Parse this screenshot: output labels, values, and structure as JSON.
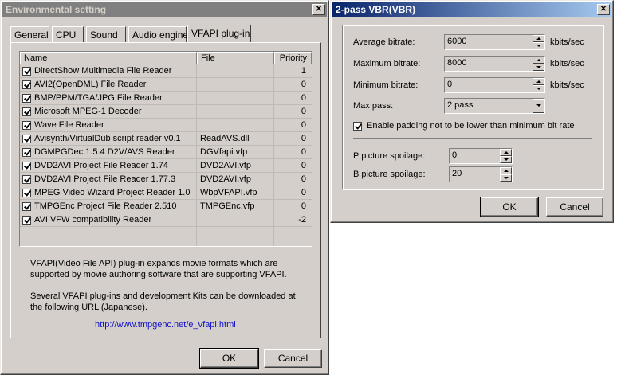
{
  "env_window": {
    "title": "Environmental setting",
    "tabs": [
      "General",
      "CPU",
      "Sound",
      "Audio engine",
      "VFAPI plug-in"
    ],
    "columns": [
      "Name",
      "File",
      "Priority"
    ],
    "rows": [
      {
        "name": "DirectShow Multimedia File Reader",
        "file": "",
        "priority": "1"
      },
      {
        "name": "AVI2(OpenDML) File Reader",
        "file": "",
        "priority": "0"
      },
      {
        "name": "BMP/PPM/TGA/JPG File Reader",
        "file": "",
        "priority": "0"
      },
      {
        "name": "Microsoft MPEG-1 Decoder",
        "file": "",
        "priority": "0"
      },
      {
        "name": "Wave File Reader",
        "file": "",
        "priority": "0"
      },
      {
        "name": "Avisynth/VirtualDub script reader v0.1",
        "file": "ReadAVS.dll",
        "priority": "0"
      },
      {
        "name": "DGMPGDec 1.5.4 D2V/AVS Reader",
        "file": "DGVfapi.vfp",
        "priority": "0"
      },
      {
        "name": "DVD2AVI Project File Reader 1.74",
        "file": "DVD2AVI.vfp",
        "priority": "0"
      },
      {
        "name": "DVD2AVI Project File Reader 1.77.3",
        "file": "DVD2AVI.vfp",
        "priority": "0"
      },
      {
        "name": "MPEG Video Wizard Project Reader 1.0",
        "file": "WbpVFAPI.vfp",
        "priority": "0"
      },
      {
        "name": "TMPGEnc Project File Reader 2.510",
        "file": "TMPGEnc.vfp",
        "priority": "0"
      },
      {
        "name": "AVI VFW compatibility Reader",
        "file": "",
        "priority": "-2"
      }
    ],
    "desc1_line1": "VFAPI(Video File API) plug-in expands movie formats which are",
    "desc1_line2": "supported by movie authoring software that are supporting VFAPI.",
    "desc2_line1": "Several VFAPI plug-ins and development Kits can be downloaded at",
    "desc2_line2": "the following URL (Japanese).",
    "url": "http://www.tmpgenc.net/e_vfapi.html",
    "ok_label": "OK",
    "cancel_label": "Cancel",
    "close_glyph": "✕"
  },
  "vbr_window": {
    "title": "2-pass VBR(VBR)",
    "close_glyph": "✕",
    "average_bitrate_label": "Average bitrate:",
    "average_bitrate_value": "6000",
    "maximum_bitrate_label": "Maximum bitrate:",
    "maximum_bitrate_value": "8000",
    "minimum_bitrate_label": "Minimum bitrate:",
    "minimum_bitrate_value": "0",
    "unit": "kbits/sec",
    "max_pass_label": "Max pass:",
    "max_pass_value": "2 pass",
    "padding_label": "Enable padding not to be lower than minimum bit rate",
    "p_spoilage_label": "P picture spoilage:",
    "p_spoilage_value": "0",
    "b_spoilage_label": "B picture spoilage:",
    "b_spoilage_value": "20",
    "ok_label": "OK",
    "cancel_label": "Cancel"
  }
}
